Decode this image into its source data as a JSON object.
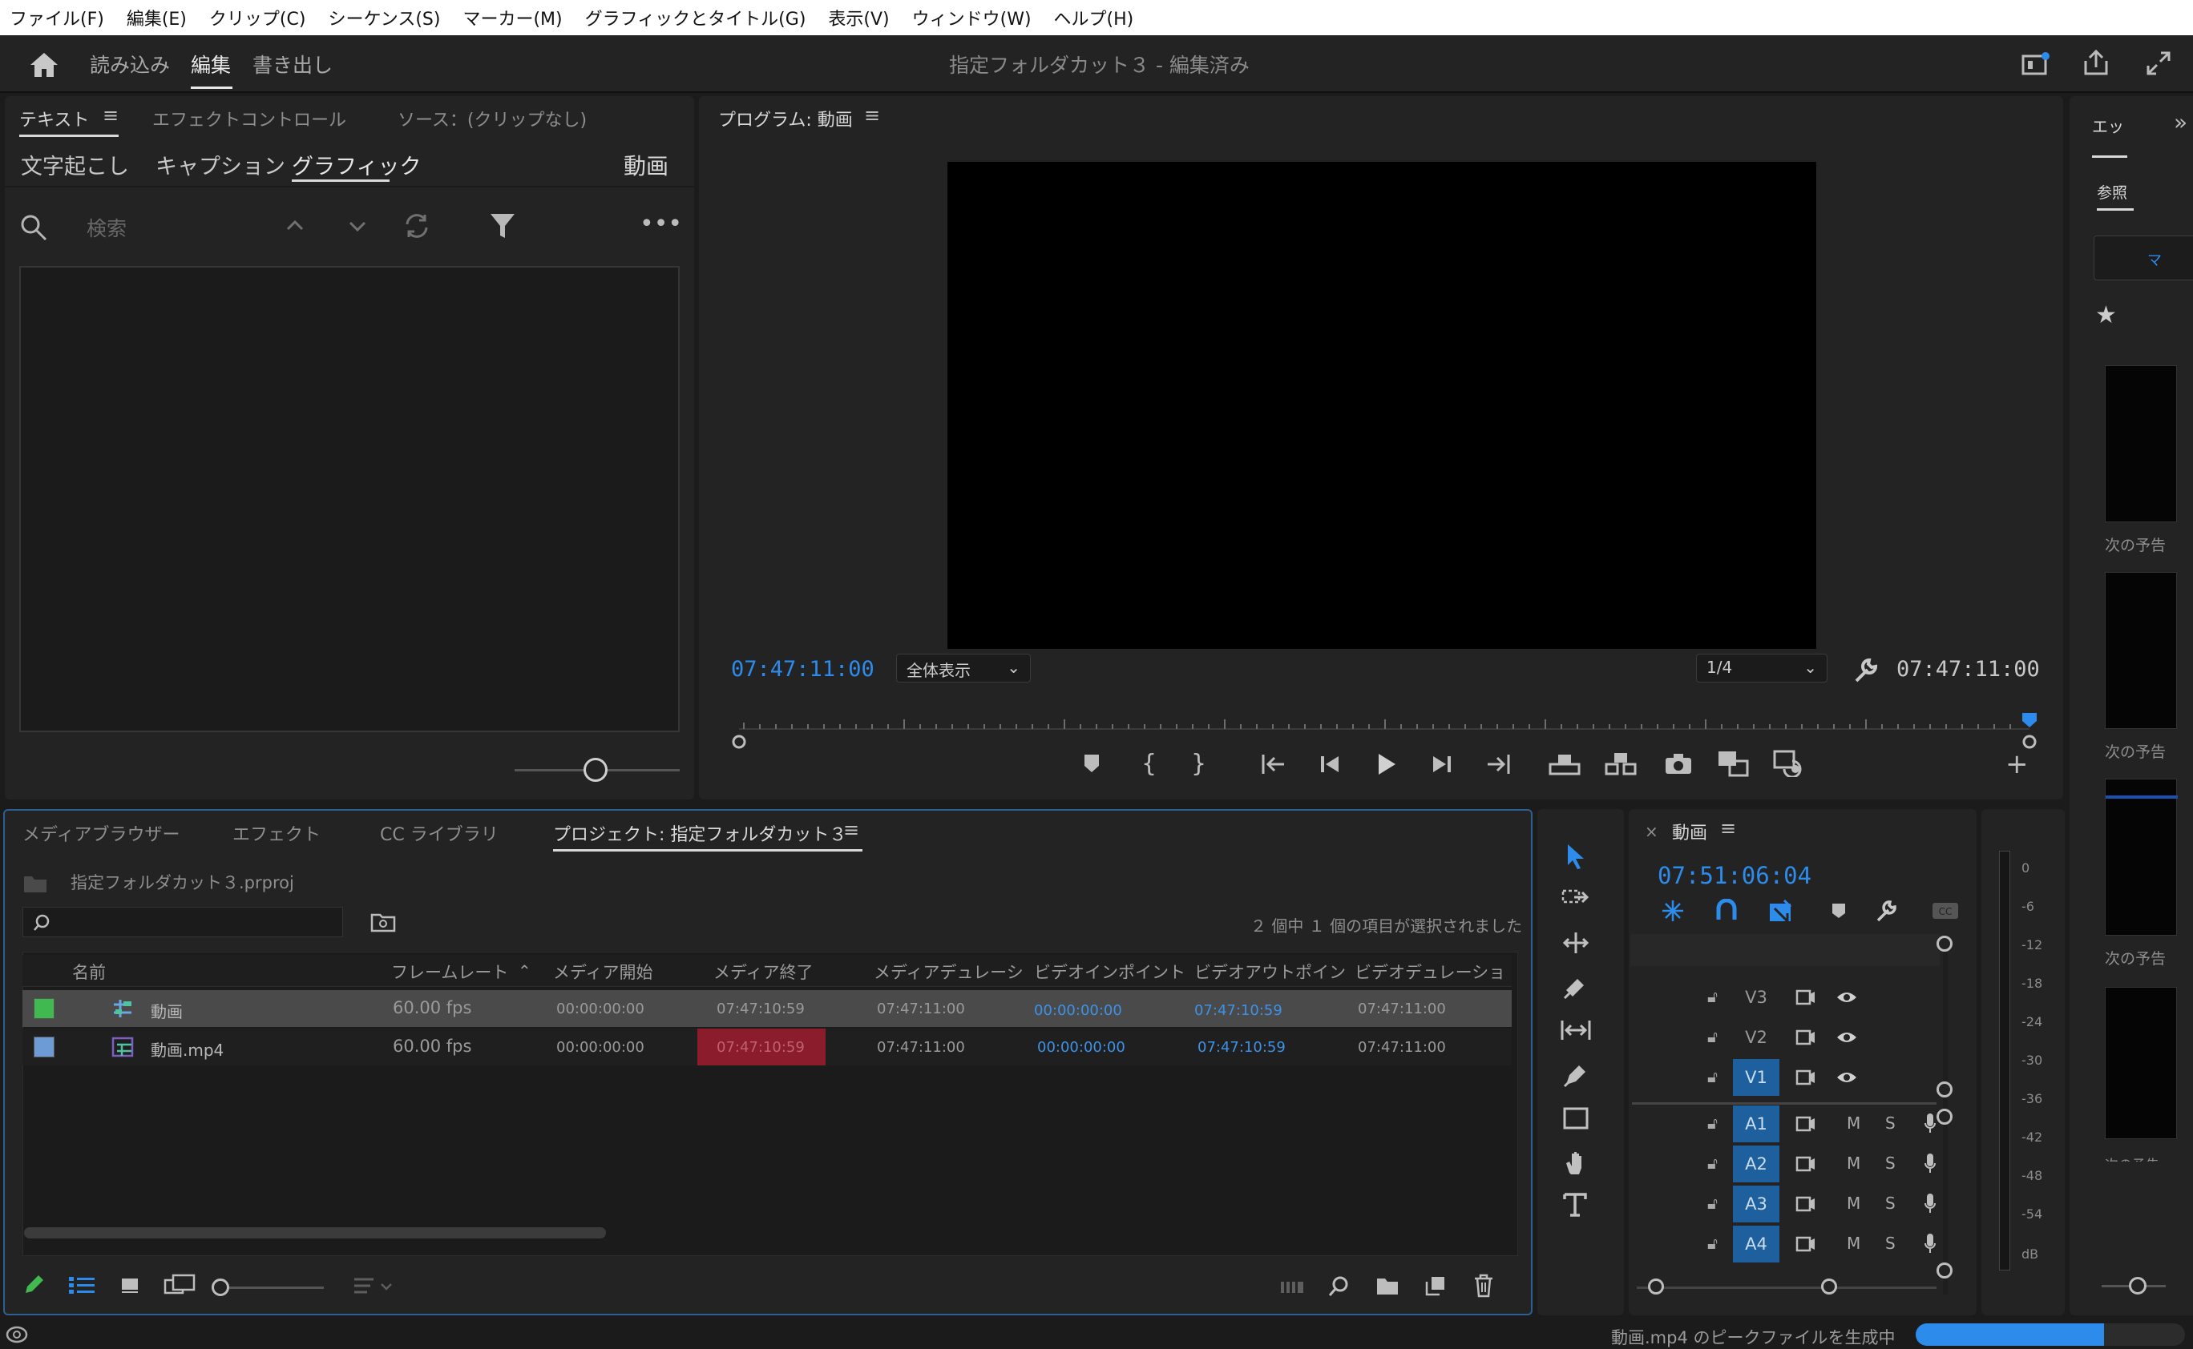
{
  "menu": [
    "ファイル(F)",
    "編集(E)",
    "クリップ(C)",
    "シーケンス(S)",
    "マーカー(M)",
    "グラフィックとタイトル(G)",
    "表示(V)",
    "ウィンドウ(W)",
    "ヘルプ(H)"
  ],
  "header": {
    "workspaces": {
      "import": "読み込み",
      "edit": "編集",
      "export": "書き出し"
    },
    "title": "指定フォルダカット３ - 編集済み"
  },
  "text_panel": {
    "tabs": {
      "text": "テキスト",
      "effect_controls": "エフェクトコントロール",
      "source": "ソース：(クリップなし)"
    },
    "subtabs": {
      "transcript": "文字起こし",
      "captions": "キャプション",
      "graphics": "グラフィック"
    },
    "sequence_name": "動画",
    "search_placeholder": "検索"
  },
  "program": {
    "title": "プログラム: 動画",
    "timecode_left": "07:47:11:00",
    "timecode_right": "07:47:11:00",
    "zoom": "全体表示",
    "resolution": "1/4"
  },
  "project_panel": {
    "tabs": {
      "media_browser": "メディアブラウザー",
      "effects": "エフェクト",
      "cc_libraries": "CC ライブラリ",
      "project": "プロジェクト: 指定フォルダカット３"
    },
    "file": "指定フォルダカット３.prproj",
    "selection_status": "２ 個中 １ 個の項目が選択されました",
    "columns": [
      "名前",
      "フレームレート",
      "メディア開始",
      "メディア終了",
      "メディアデュレーシ",
      "ビデオインポイント",
      "ビデオアウトポイン",
      "ビデオデュレーショ"
    ],
    "rows": [
      {
        "label_color": "#3fb950",
        "name": "動画",
        "fps": "60.00 fps",
        "media_start": "00:00:00:00",
        "media_end": "07:47:10:59",
        "media_duration": "07:47:11:00",
        "video_in": "00:00:00:00",
        "video_out": "07:47:10:59",
        "video_duration": "07:47:11:00"
      },
      {
        "label_color": "#6d9bd6",
        "name": "動画.mp4",
        "fps": "60.00 fps",
        "media_start": "00:00:00:00",
        "media_end": "07:47:10:59",
        "media_duration": "07:47:11:00",
        "video_in": "00:00:00:00",
        "video_out": "07:47:10:59",
        "video_duration": "07:47:11:00"
      }
    ]
  },
  "timeline": {
    "sequence": "動画",
    "timecode": "07:51:06:04",
    "video_tracks": [
      "V3",
      "V2",
      "V1"
    ],
    "audio_tracks": [
      "A1",
      "A2",
      "A3",
      "A4"
    ],
    "mute": "M",
    "solo": "S",
    "meter_scale": [
      "0",
      "-6",
      "-12",
      "-18",
      "-24",
      "-30",
      "-36",
      "-42",
      "-48",
      "-54",
      "dB"
    ]
  },
  "right_panel": {
    "tab": "エッ",
    "browse": "参照",
    "search_snippet": "マ",
    "thumb_captions": [
      "次の予告",
      "次の予告",
      "次の予告",
      "次の予告"
    ]
  },
  "status": {
    "message": "動画.mp4 のピークファイルを生成中",
    "progress": 0.7
  },
  "colors": {
    "accent": "#2d8ceb",
    "track_active": "#1e5f9e",
    "selected_cell": "#8a1c2c"
  }
}
